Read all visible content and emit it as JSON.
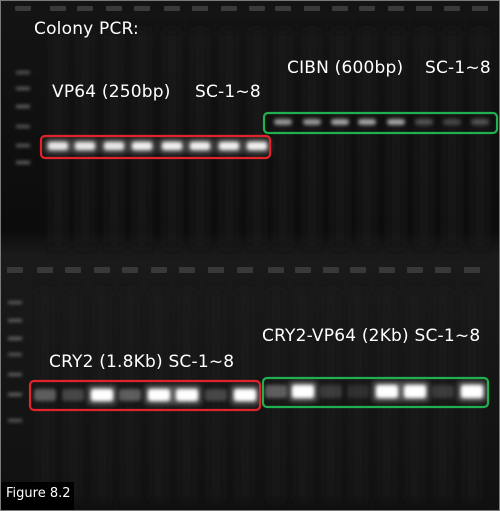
{
  "labels": {
    "title": "Colony PCR:",
    "vp64": "VP64 (250bp)",
    "vp64_sc": "SC-1~8",
    "cibn": "CIBN (600bp)",
    "cibn_sc": "SC-1~8",
    "cry2": "CRY2 (1.8Kb) SC-1~8",
    "cry2vp64": "CRY2-VP64 (2Kb) SC-1~8",
    "figure": "Figure 8.2"
  },
  "colors": {
    "background": "#000000",
    "red_box": "#e0242a",
    "green_box": "#20b050",
    "text": "#ffffff"
  },
  "band_intensity": {
    "vp64": [
      0.85,
      0.85,
      0.85,
      0.9,
      0.9,
      0.9,
      0.9,
      0.9
    ],
    "cibn": [
      0.55,
      0.55,
      0.6,
      0.6,
      0.6,
      0.25,
      0.2,
      0.25
    ],
    "cry2": [
      0.3,
      0.2,
      1.0,
      0.3,
      1.0,
      1.0,
      0.2,
      1.0
    ],
    "cry2vp64": [
      0.3,
      1.0,
      0.15,
      0.1,
      1.0,
      1.0,
      0.15,
      1.0
    ]
  }
}
